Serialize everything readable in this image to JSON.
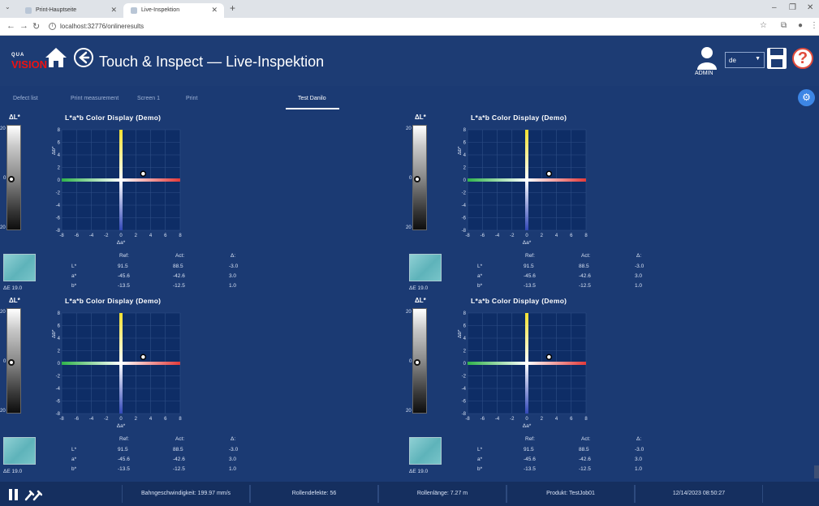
{
  "browser": {
    "tabs": [
      {
        "title": "Print-Hauptseite"
      },
      {
        "title": "Live-Inspektion"
      }
    ],
    "url": "localhost:32776/onlineresults"
  },
  "app": {
    "logo_text": "VISION",
    "logo_top": "QUA",
    "title": "Touch & Inspect — Live-Inspektion",
    "user_label": "ADMIN",
    "language": "de",
    "help_glyph": "?",
    "tabs": [
      "Defect list",
      "Print measurement",
      "Screen 1",
      "Print",
      "Test Danilo"
    ],
    "active_tab": "Test Danilo"
  },
  "panels": [
    {
      "dl_title": "ΔL*",
      "lab_title": "L*a*b Color Display (Demo)",
      "scale": {
        "top": "20",
        "mid": "0",
        "bottom": "20"
      },
      "de_label": "ΔE 19.0",
      "headers": [
        "Ref:",
        "Act:",
        "Δ:"
      ],
      "rows": [
        {
          "name": "L*",
          "ref": "91.5",
          "act": "88.5",
          "delta": "-3.0"
        },
        {
          "name": "a*",
          "ref": "-45.6",
          "act": "-42.6",
          "delta": "3.0"
        },
        {
          "name": "b*",
          "ref": "-13.5",
          "act": "-12.5",
          "delta": "1.0"
        }
      ],
      "point": {
        "a": 3,
        "b": 1
      }
    },
    {
      "dl_title": "ΔL*",
      "lab_title": "L*a*b Color Display (Demo)",
      "scale": {
        "top": "20",
        "mid": "0",
        "bottom": "20"
      },
      "de_label": "ΔE 19.0",
      "headers": [
        "Ref:",
        "Act:",
        "Δ:"
      ],
      "rows": [
        {
          "name": "L*",
          "ref": "91.5",
          "act": "88.5",
          "delta": "-3.0"
        },
        {
          "name": "a*",
          "ref": "-45.6",
          "act": "-42.6",
          "delta": "3.0"
        },
        {
          "name": "b*",
          "ref": "-13.5",
          "act": "-12.5",
          "delta": "1.0"
        }
      ],
      "point": {
        "a": 3,
        "b": 1
      }
    },
    {
      "dl_title": "ΔL*",
      "lab_title": "L*a*b Color Display (Demo)",
      "scale": {
        "top": "20",
        "mid": "0",
        "bottom": "20"
      },
      "de_label": "ΔE 19.0",
      "headers": [
        "Ref:",
        "Act:",
        "Δ:"
      ],
      "rows": [
        {
          "name": "L*",
          "ref": "91.5",
          "act": "88.5",
          "delta": "-3.0"
        },
        {
          "name": "a*",
          "ref": "-45.6",
          "act": "-42.6",
          "delta": "3.0"
        },
        {
          "name": "b*",
          "ref": "-13.5",
          "act": "-12.5",
          "delta": "1.0"
        }
      ],
      "point": {
        "a": 3,
        "b": 1
      }
    },
    {
      "dl_title": "ΔL*",
      "lab_title": "L*a*b Color Display (Demo)",
      "scale": {
        "top": "20",
        "mid": "0",
        "bottom": "20"
      },
      "de_label": "ΔE 19.0",
      "headers": [
        "Ref:",
        "Act:",
        "Δ:"
      ],
      "rows": [
        {
          "name": "L*",
          "ref": "91.5",
          "act": "88.5",
          "delta": "-3.0"
        },
        {
          "name": "a*",
          "ref": "-45.6",
          "act": "-42.6",
          "delta": "3.0"
        },
        {
          "name": "b*",
          "ref": "-13.5",
          "act": "-12.5",
          "delta": "1.0"
        }
      ],
      "point": {
        "a": 3,
        "b": 1
      }
    }
  ],
  "lab_axes": {
    "xlabel": "Δa*",
    "ylabel": "Δb*",
    "ticks": [
      "-8",
      "-6",
      "-4",
      "-2",
      "0",
      "2",
      "4",
      "6",
      "8"
    ],
    "range": [
      -8,
      8
    ]
  },
  "footer": {
    "speed": "Bahngeschwindigkeit: 199.97 mm/s",
    "defects": "Rollendefekte: 56",
    "length": "Rollenlänge: 7.27 m",
    "product": "Produkt: TestJob01",
    "datetime": "12/14/2023 08:50:27"
  },
  "colors": {
    "app_bg": "#1b3a73",
    "chart_bg": "#0e2d66",
    "accent": "#3d86e5",
    "help": "#e14b3c"
  },
  "icons": [
    "home-icon",
    "back-arrow-icon",
    "user-icon",
    "save-disk-icon",
    "help-icon",
    "gear-icon",
    "pause-icon",
    "tools-icon"
  ]
}
